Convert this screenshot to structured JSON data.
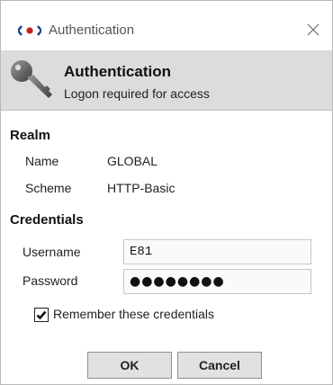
{
  "window": {
    "title": "Authentication"
  },
  "banner": {
    "title": "Authentication",
    "subtitle": "Logon required for access"
  },
  "realm": {
    "heading": "Realm",
    "name_label": "Name",
    "name_value": "GLOBAL",
    "scheme_label": "Scheme",
    "scheme_value": "HTTP-Basic"
  },
  "credentials": {
    "heading": "Credentials",
    "username_label": "Username",
    "username_value": "E81",
    "password_label": "Password",
    "password_value": "●●●●●●●●",
    "remember_label": "Remember these credentials",
    "remember_checked": true
  },
  "buttons": {
    "ok_label": "OK",
    "cancel_label": "Cancel"
  },
  "icons": {
    "app": "niagara-logo-icon",
    "close": "close-icon",
    "banner": "key-icon",
    "checkbox": "checkmark-icon"
  },
  "colors": {
    "banner_background": "#dcdcdc",
    "button_background": "#e1e1e1",
    "logo_blue": "#1f3f8f",
    "logo_red": "#c81e1e"
  }
}
